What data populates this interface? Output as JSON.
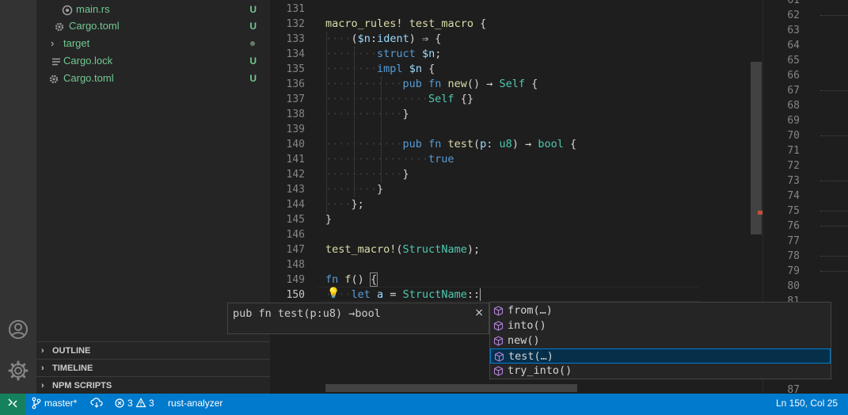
{
  "explorer": {
    "items": [
      {
        "label": "main.rs",
        "status": "U",
        "icon": "rust-file-icon"
      },
      {
        "label": "Cargo.toml",
        "status": "U",
        "icon": "gear-icon"
      },
      {
        "label": "target",
        "status": "",
        "icon": "chevron-right-icon"
      },
      {
        "label": "Cargo.lock",
        "status": "U",
        "icon": "list-icon"
      },
      {
        "label": "Cargo.toml",
        "status": "U",
        "icon": "gear-icon"
      }
    ],
    "panels": [
      "OUTLINE",
      "TIMELINE",
      "NPM SCRIPTS"
    ]
  },
  "editor": {
    "line_numbers": [
      "131",
      "132",
      "133",
      "134",
      "135",
      "136",
      "137",
      "138",
      "139",
      "140",
      "141",
      "142",
      "143",
      "144",
      "145",
      "146",
      "147",
      "148",
      "149",
      "150"
    ],
    "cursor_line_text": "150"
  },
  "minimap_lines": [
    "61",
    "62",
    "63",
    "64",
    "65",
    "66",
    "67",
    "68",
    "69",
    "70",
    "71",
    "72",
    "73",
    "74",
    "75",
    "76",
    "77",
    "78",
    "79",
    "80",
    "81",
    "87"
  ],
  "signature": {
    "text": "pub fn test(p:u8) →bool",
    "close": "×"
  },
  "suggestions": [
    {
      "label": "from(…)",
      "selected": false
    },
    {
      "label": "into()",
      "selected": false
    },
    {
      "label": "new()",
      "selected": false
    },
    {
      "label": "test(…)",
      "selected": true
    },
    {
      "label": "try_into()",
      "selected": false
    }
  ],
  "statusbar": {
    "branch": "master*",
    "errors": "3",
    "warnings": "3",
    "language_server": "rust-analyzer",
    "position": "Ln 150, Col 25"
  },
  "colors": {
    "accent": "#007acc",
    "remote": "#16825d",
    "untracked": "#73c991",
    "selection": "#062f4a"
  }
}
